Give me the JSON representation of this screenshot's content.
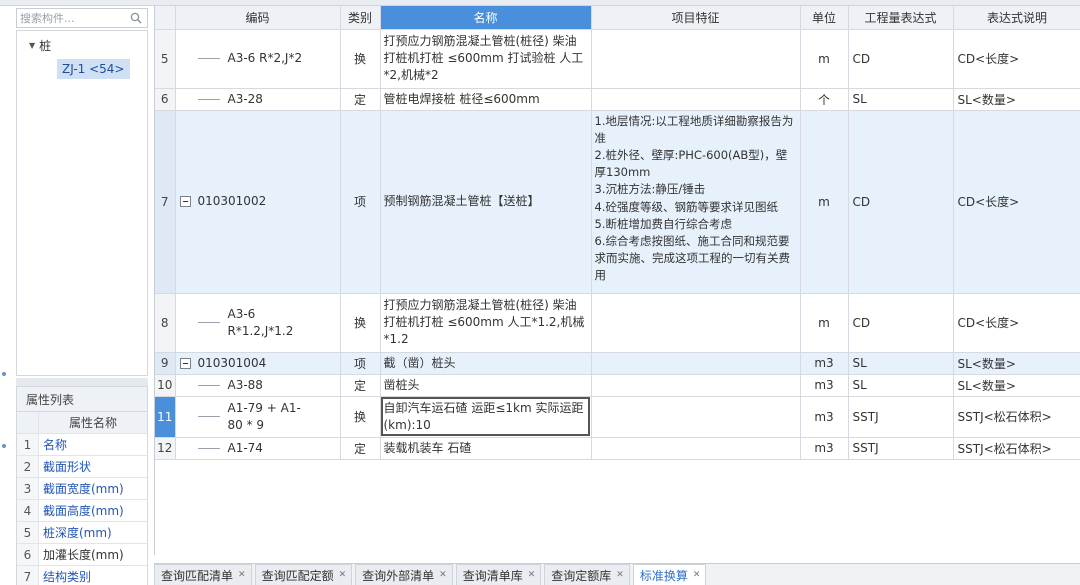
{
  "search": {
    "placeholder": "搜索构件..."
  },
  "tree": {
    "root_label": "桩",
    "child_label": "ZJ-1 <54>"
  },
  "properties": {
    "title": "属性列表",
    "header": "属性名称",
    "rows": [
      {
        "num": "1",
        "name": "名称"
      },
      {
        "num": "2",
        "name": "截面形状"
      },
      {
        "num": "3",
        "name": "截面宽度(mm)"
      },
      {
        "num": "4",
        "name": "截面高度(mm)"
      },
      {
        "num": "5",
        "name": "桩深度(mm)"
      },
      {
        "num": "6",
        "name": "加灌长度(mm)"
      },
      {
        "num": "7",
        "name": "结构类别"
      }
    ]
  },
  "grid": {
    "columns": [
      "编码",
      "类别",
      "名称",
      "项目特征",
      "单位",
      "工程量表达式",
      "表达式说明"
    ],
    "rows": [
      {
        "num": "5",
        "code": "A3-6 R*2,J*2",
        "type": "换",
        "name": "打预应力钢筋混凝土管桩(桩径) 柴油打桩机打桩 ≤600mm  打试验桩 人工*2,机械*2",
        "feature": "",
        "unit": "m",
        "expr": "CD",
        "desc": "CD<长度>"
      },
      {
        "num": "6",
        "code": "A3-28",
        "type": "定",
        "name": "管桩电焊接桩 桩径≤600mm",
        "feature": "",
        "unit": "个",
        "expr": "SL",
        "desc": "SL<数量>"
      },
      {
        "num": "7",
        "code": "010301002",
        "type": "项",
        "name": "预制钢筋混凝土管桩【送桩】",
        "feature": "1.地层情况:以工程地质详细勘察报告为准\n2.桩外径、壁厚:PHC-600(AB型)，壁厚130mm\n3.沉桩方法:静压/锤击\n4.砼强度等级、钢筋等要求详见图纸\n5.断桩增加费自行综合考虑\n6.综合考虑按图纸、施工合同和规范要求而实施、完成这项工程的一切有关费用",
        "unit": "m",
        "expr": "CD",
        "desc": "CD<长度>"
      },
      {
        "num": "8",
        "code": "A3-6 R*1.2,J*1.2",
        "type": "换",
        "name": "打预应力钢筋混凝土管桩(桩径) 柴油打桩机打桩 ≤600mm  人工*1.2,机械*1.2",
        "feature": "",
        "unit": "m",
        "expr": "CD",
        "desc": "CD<长度>"
      },
      {
        "num": "9",
        "code": "010301004",
        "type": "项",
        "name": "截（凿）桩头",
        "feature": "",
        "unit": "m3",
        "expr": "SL",
        "desc": "SL<数量>"
      },
      {
        "num": "10",
        "code": "A3-88",
        "type": "定",
        "name": "凿桩头",
        "feature": "",
        "unit": "m3",
        "expr": "SL",
        "desc": "SL<数量>"
      },
      {
        "num": "11",
        "code": "A1-79 + A1-80 * 9",
        "type": "换",
        "name": "自卸汽车运石碴 运距≤1km  实际运距(km):10",
        "feature": "",
        "unit": "m3",
        "expr": "SSTJ",
        "desc": "SSTJ<松石体积>"
      },
      {
        "num": "12",
        "code": "A1-74",
        "type": "定",
        "name": "装载机装车 石碴",
        "feature": "",
        "unit": "m3",
        "expr": "SSTJ",
        "desc": "SSTJ<松石体积>"
      }
    ]
  },
  "tabs": [
    {
      "label": "查询匹配清单"
    },
    {
      "label": "查询匹配定额"
    },
    {
      "label": "查询外部清单"
    },
    {
      "label": "查询清单库"
    },
    {
      "label": "查询定额库"
    },
    {
      "label": "标准换算"
    }
  ],
  "icons": {
    "search": "search-icon",
    "close": "close-icon",
    "expand": "collapse-icon",
    "caret": "caret-down-icon"
  },
  "colors": {
    "accent": "#4a8fdc",
    "highlight_row": "#e6f1fb",
    "prop_link": "#2255b8"
  }
}
